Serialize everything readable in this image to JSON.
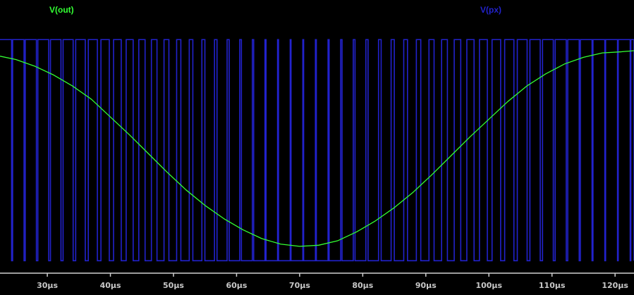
{
  "chart_data": {
    "type": "line",
    "x_unit": "µs",
    "xlim": [
      22.5,
      123
    ],
    "ylim": [
      -1.1,
      1.18
    ],
    "grid": false,
    "legend": "top",
    "x_ticks": [
      {
        "value": 30,
        "label": "30µs"
      },
      {
        "value": 40,
        "label": "40µs"
      },
      {
        "value": 50,
        "label": "50µs"
      },
      {
        "value": 60,
        "label": "60µs"
      },
      {
        "value": 70,
        "label": "70µs"
      },
      {
        "value": 80,
        "label": "80µs"
      },
      {
        "value": 90,
        "label": "90µs"
      },
      {
        "value": 100,
        "label": "100µs"
      },
      {
        "value": 110,
        "label": "110µs"
      },
      {
        "value": 120,
        "label": "120µs"
      }
    ],
    "series": [
      {
        "name": "V(out)",
        "color": "#33ff33",
        "kind": "analog",
        "x": [
          22.5,
          25,
          28,
          31,
          34,
          37,
          40,
          43,
          46,
          49,
          52,
          55,
          58,
          61,
          64,
          67,
          70,
          73,
          76,
          79,
          82,
          85,
          88,
          91,
          94,
          97,
          100,
          103,
          106,
          109,
          112,
          115,
          118,
          121,
          123
        ],
        "y": [
          0.85,
          0.82,
          0.76,
          0.68,
          0.58,
          0.46,
          0.3,
          0.14,
          -0.03,
          -0.2,
          -0.36,
          -0.5,
          -0.62,
          -0.72,
          -0.8,
          -0.85,
          -0.87,
          -0.86,
          -0.82,
          -0.74,
          -0.64,
          -0.52,
          -0.38,
          -0.22,
          -0.05,
          0.12,
          0.28,
          0.44,
          0.58,
          0.69,
          0.78,
          0.84,
          0.88,
          0.89,
          0.9
        ]
      },
      {
        "name": "V(px)",
        "color": "#2222cc",
        "kind": "pwm",
        "high": 1.0,
        "low": -1.0,
        "period": 2,
        "x_start": 22.5,
        "x_end": 123,
        "note": "duty cycle follows V(out)"
      }
    ]
  }
}
